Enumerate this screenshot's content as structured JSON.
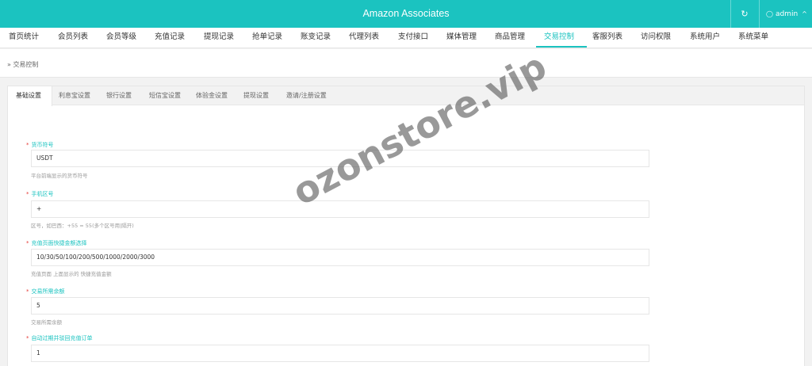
{
  "header": {
    "title": "Amazon Associates",
    "refresh_icon": "↻",
    "user": "admin",
    "user_icon": "user-icon",
    "chevron_icon": "^"
  },
  "nav": {
    "items": [
      "首页统计",
      "会员列表",
      "会员等级",
      "充值记录",
      "提现记录",
      "抢单记录",
      "账变记录",
      "代理列表",
      "支付接口",
      "媒体管理",
      "商品管理",
      "交易控制",
      "客服列表",
      "访问权限",
      "系统用户",
      "系统菜单"
    ],
    "active": "交易控制"
  },
  "breadcrumb": "» 交易控制",
  "tabs": {
    "items": [
      "基础设置",
      "利息宝设置",
      "银行设置",
      "短信宝设置",
      "体验金设置",
      "提现设置",
      "邀请/注册设置"
    ],
    "active": "基础设置"
  },
  "form": {
    "fields": [
      {
        "label": "货币符号",
        "value": "USDT",
        "help": "平台前端显示的货币符号"
      },
      {
        "label": "手机区号",
        "value": "+",
        "help": "区号，如巴西：+55 = 55(多个区号用|隔开)"
      },
      {
        "label": "充值页面快捷金额选择",
        "value": "10/30/50/100/200/500/1000/2000/3000",
        "help": "充值页面 上面显示的 快捷充值金额"
      },
      {
        "label": "交易所需余额",
        "value": "5",
        "help": "交易所需余额"
      },
      {
        "label": "自动过期并驳回充值订单",
        "value": "1",
        "help": ""
      }
    ]
  },
  "watermark": "ozonstore.vip",
  "colors": {
    "accent": "#1bc3c0",
    "required": "#e53935"
  }
}
